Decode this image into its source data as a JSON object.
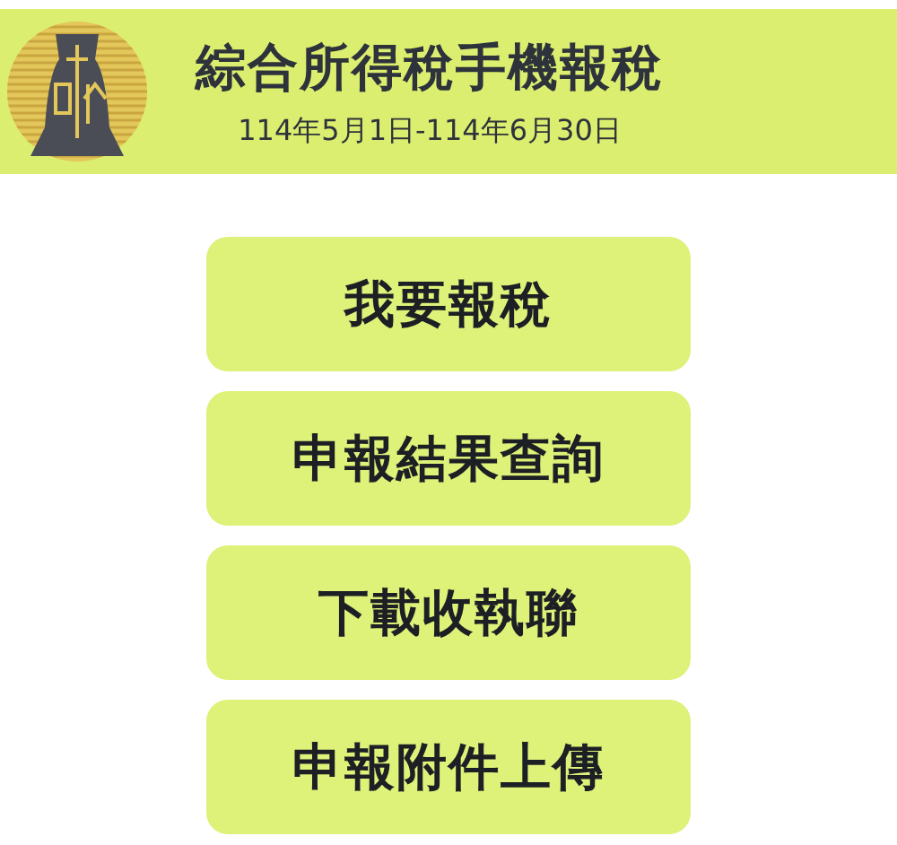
{
  "header": {
    "title": "綜合所得稅手機報稅",
    "period": "114年5月1日-114年6月30日"
  },
  "buttons": [
    "我要報稅",
    "申報結果查詢",
    "下載收執聯",
    "申報附件上傳"
  ]
}
